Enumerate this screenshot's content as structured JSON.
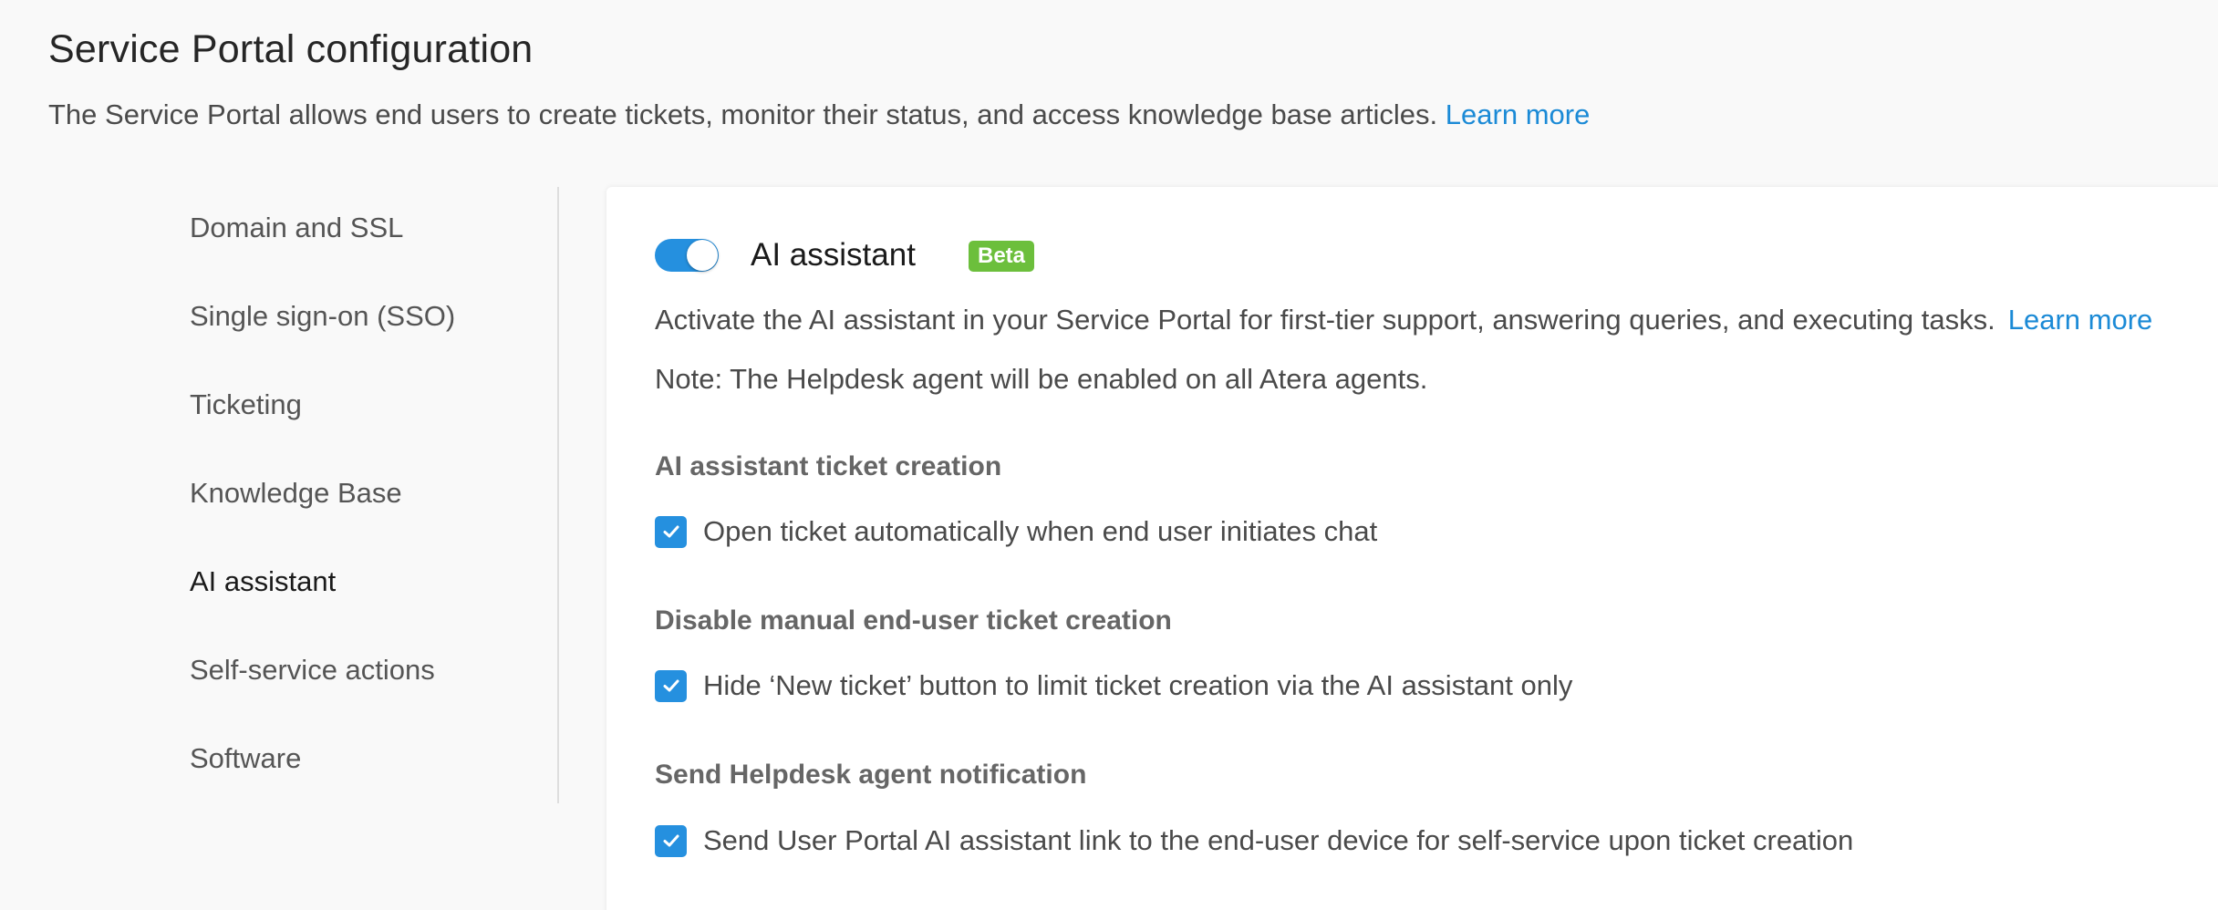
{
  "header": {
    "title": "Service Portal configuration",
    "description": "The Service Portal allows end users to create tickets, monitor their status, and access knowledge base articles.",
    "learn_more": "Learn more"
  },
  "sidebar": {
    "items": [
      {
        "label": "Domain and SSL"
      },
      {
        "label": "Single sign-on (SSO)"
      },
      {
        "label": "Ticketing"
      },
      {
        "label": "Knowledge Base"
      },
      {
        "label": "AI assistant",
        "active": true
      },
      {
        "label": "Self-service actions"
      },
      {
        "label": "Software"
      }
    ]
  },
  "panel": {
    "toggle_enabled": true,
    "title": "AI assistant",
    "badge": "Beta",
    "intro": "Activate the AI assistant in your Service Portal for first-tier support, answering queries, and executing tasks.",
    "intro_link": "Learn more",
    "note": "Note: The Helpdesk agent will be enabled on all Atera agents.",
    "groups": [
      {
        "title": "AI assistant ticket creation",
        "option": "Open ticket automatically when end user initiates chat",
        "checked": true
      },
      {
        "title": "Disable manual end-user ticket creation",
        "option": "Hide ‘New ticket’ button to limit ticket creation via the AI assistant only",
        "checked": true
      },
      {
        "title": "Send Helpdesk agent notification",
        "option": "Send User Portal AI assistant link to the end-user device for self-service upon ticket creation",
        "checked": true
      }
    ]
  },
  "colors": {
    "accent": "#2590df",
    "link": "#1b8ad6",
    "beta": "#6cbf3c"
  }
}
